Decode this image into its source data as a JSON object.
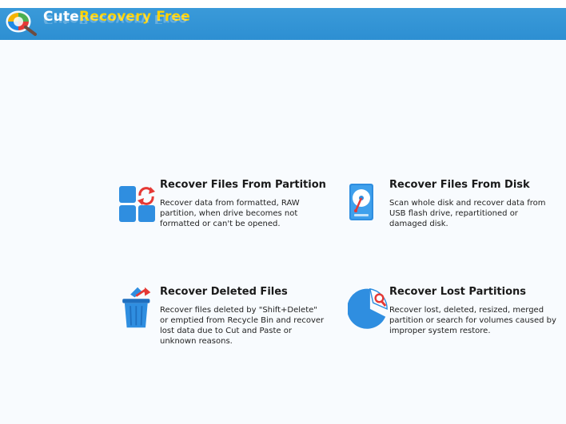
{
  "app": {
    "title_part1": "Cute",
    "title_part2": "Recovery Free"
  },
  "colors": {
    "titlebar": "#2d8fd2",
    "accent": "#ffd200",
    "icon_blue": "#2f8ee0",
    "icon_red": "#e53935",
    "background": "#f8fbfe"
  },
  "options": [
    {
      "id": "recover-files-from-partition",
      "icon": "partition-recover-icon",
      "title": "Recover Files From Partition",
      "description": "Recover data from formatted, RAW partition, when drive becomes not formatted or can't be opened."
    },
    {
      "id": "recover-files-from-disk",
      "icon": "hard-disk-icon",
      "title": "Recover Files From Disk",
      "description": "Scan whole disk and recover data from USB flash drive, repartitioned or damaged disk."
    },
    {
      "id": "recover-deleted-files",
      "icon": "recycle-bin-icon",
      "title": "Recover Deleted Files",
      "description": "Recover files deleted by \"Shift+Delete\" or emptied from Recycle Bin and recover lost data due to Cut and Paste or unknown reasons."
    },
    {
      "id": "recover-lost-partitions",
      "icon": "lost-partition-icon",
      "title": "Recover Lost Partitions",
      "description": "Recover lost, deleted, resized, merged partition or search for volumes caused by improper system restore."
    }
  ]
}
